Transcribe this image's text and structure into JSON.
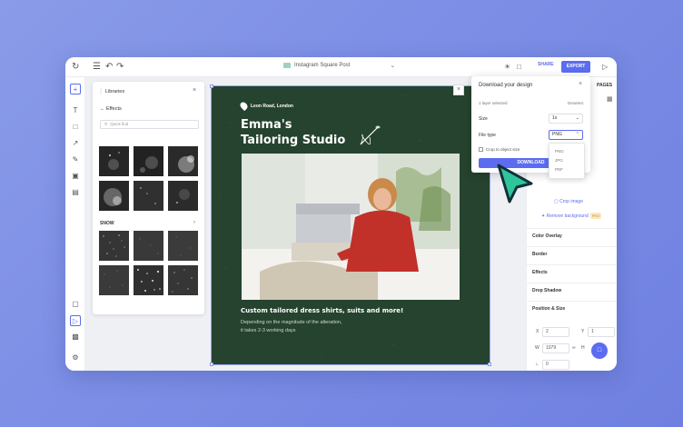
{
  "topbar": {
    "document_title": "Instagram Square Post",
    "share_label": "SHARE",
    "export_label": "EXPORT"
  },
  "libraries": {
    "title": "Libraries",
    "back_label": "Effects",
    "search_placeholder": "Quick find",
    "section_label": "SNOW"
  },
  "design": {
    "location": "Leon Road, London",
    "headline_line1": "Emma's",
    "headline_line2": "Tailoring Studio",
    "tagline": "Custom tailored dress shirts, suits and more!",
    "desc_line1": "Depending on the magnitude of the alteration,",
    "desc_line2": "it takes 2-3 working days",
    "background_color": "#25432e"
  },
  "download_dialog": {
    "title": "Download your design",
    "layer_selected": "1 layer selected",
    "deselect_label": "Deselect",
    "size_label": "Size",
    "size_value": "1x",
    "file_type_label": "File type",
    "file_type_value": "PNG",
    "file_type_options": [
      "PNG",
      "JPG",
      "PDF"
    ],
    "crop_label": "Crop to object size",
    "download_label": "DOWNLOAD"
  },
  "right_panel": {
    "tab_pages": "PAGES",
    "crop_image": "Crop image",
    "remove_background": "Remove background",
    "remove_background_badge": "PRO",
    "sections": [
      "Color Overlay",
      "Border",
      "Effects",
      "Drop Shadow",
      "Position & Size"
    ],
    "x_label": "X",
    "x_value": "2",
    "y_label": "Y",
    "y_value": "1",
    "w_label": "W",
    "w_value": "1079",
    "h_label": "H",
    "rotation_value": "0"
  },
  "colors": {
    "accent": "#5b6cf0",
    "cursor": "#2fc49a"
  }
}
